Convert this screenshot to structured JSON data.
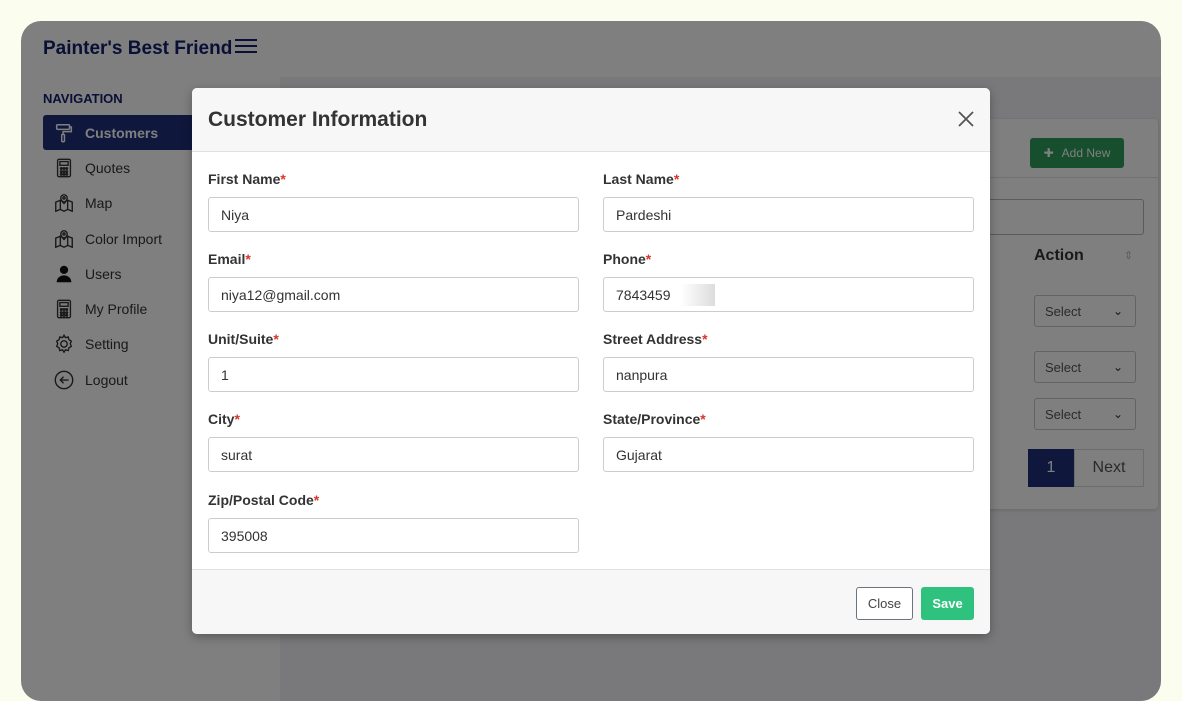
{
  "app": {
    "title": "Painter's Best Friend"
  },
  "sidebar": {
    "heading": "NAVIGATION",
    "items": [
      {
        "label": "Customers",
        "icon": "paint-roller-icon",
        "active": true
      },
      {
        "label": "Quotes",
        "icon": "calculator-icon"
      },
      {
        "label": "Map",
        "icon": "map-pin-icon"
      },
      {
        "label": "Color Import",
        "icon": "map-pin-icon"
      },
      {
        "label": "Users",
        "icon": "user-icon"
      },
      {
        "label": "My Profile",
        "icon": "calculator-icon"
      },
      {
        "label": "Setting",
        "icon": "gear-icon"
      },
      {
        "label": "Logout",
        "icon": "logout-icon"
      }
    ]
  },
  "background_table": {
    "add_new_label": "Add New",
    "action_header": "Action",
    "select_label": "Select",
    "pagination": {
      "current_page": "1",
      "next_label": "Next"
    }
  },
  "modal": {
    "title": "Customer Information",
    "fields": {
      "first_name": {
        "label": "First Name",
        "value": "Niya"
      },
      "last_name": {
        "label": "Last Name",
        "value": "Pardeshi"
      },
      "email": {
        "label": "Email",
        "value": "niya12@gmail.com"
      },
      "phone": {
        "label": "Phone",
        "value": "7843459"
      },
      "unit": {
        "label": "Unit/Suite",
        "value": "1"
      },
      "street": {
        "label": "Street Address",
        "value": "nanpura"
      },
      "city": {
        "label": "City",
        "value": "surat"
      },
      "state": {
        "label": "State/Province",
        "value": "Gujarat"
      },
      "zip": {
        "label": "Zip/Postal Code",
        "value": "395008"
      }
    },
    "required_marker": "*",
    "close_label": "Close",
    "save_label": "Save"
  },
  "colors": {
    "brand_navy": "#14206b",
    "active_nav": "#1e2f7a",
    "save_green": "#2ec27e",
    "add_new_green": "#2f9d5a",
    "required_red": "#d9342b"
  }
}
